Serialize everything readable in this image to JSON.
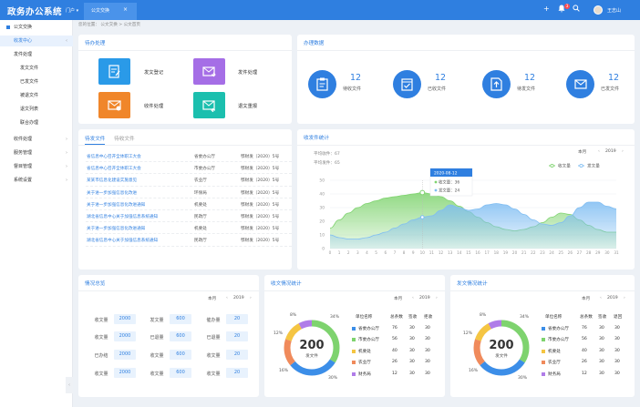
{
  "app": {
    "title": "政务办公系统",
    "portal": "门户",
    "tab": "公文交换",
    "tab_close": "×",
    "user": "王志山",
    "notification_count": "3"
  },
  "breadcrumb": "您的位置：  公文交换 > 公文首页",
  "sidebar": {
    "items": [
      {
        "label": "公文交换",
        "level": 0
      },
      {
        "label": "收发中心",
        "level": 1,
        "arrow": "‹"
      },
      {
        "label": "发件处理",
        "level": 2
      },
      {
        "label": "发文文件",
        "level": 3
      },
      {
        "label": "已发文件",
        "level": 3
      },
      {
        "label": "被退文件",
        "level": 3
      },
      {
        "label": "退文列表",
        "level": 3
      },
      {
        "label": "联合办理",
        "level": 3
      },
      {
        "label": "收件处理",
        "level": 1,
        "arrow": "›"
      },
      {
        "label": "服务管理",
        "level": 1,
        "arrow": "›"
      },
      {
        "label": "督目管理",
        "level": 1,
        "arrow": "›"
      },
      {
        "label": "系统设置",
        "level": 1,
        "arrow": "›"
      }
    ]
  },
  "todo": {
    "title": "待办处理",
    "buttons": [
      {
        "label": "发文登记",
        "color": "#2a9ae8",
        "icon": "doc-edit-icon"
      },
      {
        "label": "发件处理",
        "color": "#a56ee6",
        "icon": "mail-send-icon"
      },
      {
        "label": "收件处理",
        "color": "#f0862a",
        "icon": "mail-receive-icon"
      },
      {
        "label": "退文重报",
        "color": "#1bbfae",
        "icon": "mail-return-icon"
      }
    ]
  },
  "stats": {
    "title": "办理数据",
    "items": [
      {
        "value": "12",
        "label": "待收文件",
        "icon": "clipboard-icon"
      },
      {
        "value": "12",
        "label": "已收文件",
        "icon": "calendar-check-icon"
      },
      {
        "value": "12",
        "label": "待发文件",
        "icon": "doc-upload-icon"
      },
      {
        "value": "12",
        "label": "已发文件",
        "icon": "mail-icon"
      }
    ]
  },
  "docs": {
    "tabs": [
      "待发文件",
      "待收文件"
    ],
    "rows": [
      [
        "省信息中心召开全体职工大会",
        "省委办公厅",
        "鄂财发（2020）5号"
      ],
      [
        "省信息中心召开全体职工大会",
        "市委办公厅",
        "鄂财发（2020）5号"
      ],
      [
        "某某市信息化建设实施意见",
        "农业厅",
        "鄂财发（2020）5号"
      ],
      [
        "关于进一步加强信息化改进",
        "环保局",
        "鄂财发（2020）5号"
      ],
      [
        "关于进一步加强信息化改进通知",
        "机要处",
        "鄂财发（2020）5号"
      ],
      [
        "湖北省信息中心关于加强信息系统通知",
        "民政厅",
        "鄂财发（2020）5号"
      ],
      [
        "关于进一步加强信息化改进通知",
        "机要处",
        "鄂财发（2020）5号"
      ],
      [
        "湖北省信息中心关于加强信息系统通知",
        "民政厅",
        "鄂财发（2020）5号"
      ]
    ]
  },
  "chart_panel": {
    "title": "收发件统计",
    "avg_receive": "平均收件：67",
    "avg_send": "平均发件：65",
    "period": "本月",
    "year": "2019",
    "tooltip": {
      "date": "2020-08-12",
      "receive": "收文量：36",
      "send": "发文量：24"
    }
  },
  "chart_data": {
    "type": "area",
    "x": [
      0,
      1,
      2,
      3,
      4,
      5,
      6,
      7,
      8,
      9,
      10,
      11,
      12,
      13,
      14,
      15,
      16,
      17,
      18,
      19,
      20,
      21,
      22,
      23,
      24,
      25,
      26,
      27,
      28,
      29,
      30,
      31
    ],
    "ylim": [
      0,
      50
    ],
    "yticks": [
      0,
      10,
      20,
      30,
      40,
      50
    ],
    "legend_position": "top-right",
    "series": [
      {
        "name": "收文量",
        "color": "#7ed36e",
        "values": [
          15,
          21,
          26,
          30,
          33,
          35,
          37,
          38,
          39,
          40,
          41,
          40,
          38,
          35,
          31,
          27,
          23,
          19,
          16,
          14,
          13,
          14,
          16,
          19,
          23,
          26,
          25,
          21,
          17,
          14,
          12,
          12
        ]
      },
      {
        "name": "发文量",
        "color": "#7fbdf2",
        "values": [
          10,
          8,
          7,
          7,
          8,
          10,
          12,
          15,
          18,
          21,
          23,
          24,
          28,
          32,
          30,
          28,
          29,
          32,
          33,
          32,
          29,
          25,
          21,
          18,
          17,
          19,
          24,
          30,
          34,
          34,
          31,
          29
        ]
      }
    ]
  },
  "situation": {
    "title": "情况总览",
    "period": "本月",
    "year": "2019",
    "rows": [
      [
        [
          "收文量",
          "2000"
        ],
        [
          "发文量",
          "600"
        ],
        [
          "催办量",
          "20"
        ]
      ],
      [
        [
          "收文量",
          "2000"
        ],
        [
          "已退量",
          "600"
        ],
        [
          "已退量",
          "20"
        ]
      ],
      [
        [
          "已办结",
          "2000"
        ],
        [
          "收文量",
          "600"
        ],
        [
          "收文量",
          "20"
        ]
      ],
      [
        [
          "收文量",
          "2000"
        ],
        [
          "收文量",
          "600"
        ],
        [
          "收文量",
          "20"
        ]
      ]
    ]
  },
  "receive_stats": {
    "title": "收文情况统计",
    "period": "本月",
    "year": "2019",
    "total": "200",
    "total_label": "发文件",
    "headers": [
      "单位名称",
      "总条数",
      "签收",
      "拒收"
    ],
    "rows": [
      {
        "name": "省委办公厅",
        "color": "#3c8ee8",
        "v": [
          "76",
          "30",
          "30"
        ]
      },
      {
        "name": "市委办公厅",
        "color": "#7ed36e",
        "v": [
          "56",
          "30",
          "30"
        ]
      },
      {
        "name": "机要处",
        "color": "#f5c542",
        "v": [
          "40",
          "30",
          "30"
        ]
      },
      {
        "name": "农业厅",
        "color": "#f08a5b",
        "v": [
          "26",
          "30",
          "30"
        ]
      },
      {
        "name": "财务局",
        "color": "#b07ce8",
        "v": [
          "12",
          "30",
          "30"
        ]
      }
    ],
    "percents": [
      "8%",
      "34%",
      "12%",
      "16%",
      "30%"
    ]
  },
  "send_stats": {
    "title": "发文情况统计",
    "period": "本月",
    "year": "2019",
    "total": "200",
    "total_label": "发文件",
    "headers": [
      "单位名称",
      "总条数",
      "签收",
      "退回"
    ],
    "rows": [
      {
        "name": "省委办公厅",
        "color": "#3c8ee8",
        "v": [
          "76",
          "30",
          "30"
        ]
      },
      {
        "name": "市委办公厅",
        "color": "#7ed36e",
        "v": [
          "56",
          "30",
          "30"
        ]
      },
      {
        "name": "机要处",
        "color": "#f5c542",
        "v": [
          "40",
          "30",
          "30"
        ]
      },
      {
        "name": "农业厅",
        "color": "#f08a5b",
        "v": [
          "26",
          "30",
          "30"
        ]
      },
      {
        "name": "财务局",
        "color": "#b07ce8",
        "v": [
          "12",
          "30",
          "30"
        ]
      }
    ],
    "percents": [
      "8%",
      "34%",
      "12%",
      "16%",
      "30%"
    ]
  }
}
